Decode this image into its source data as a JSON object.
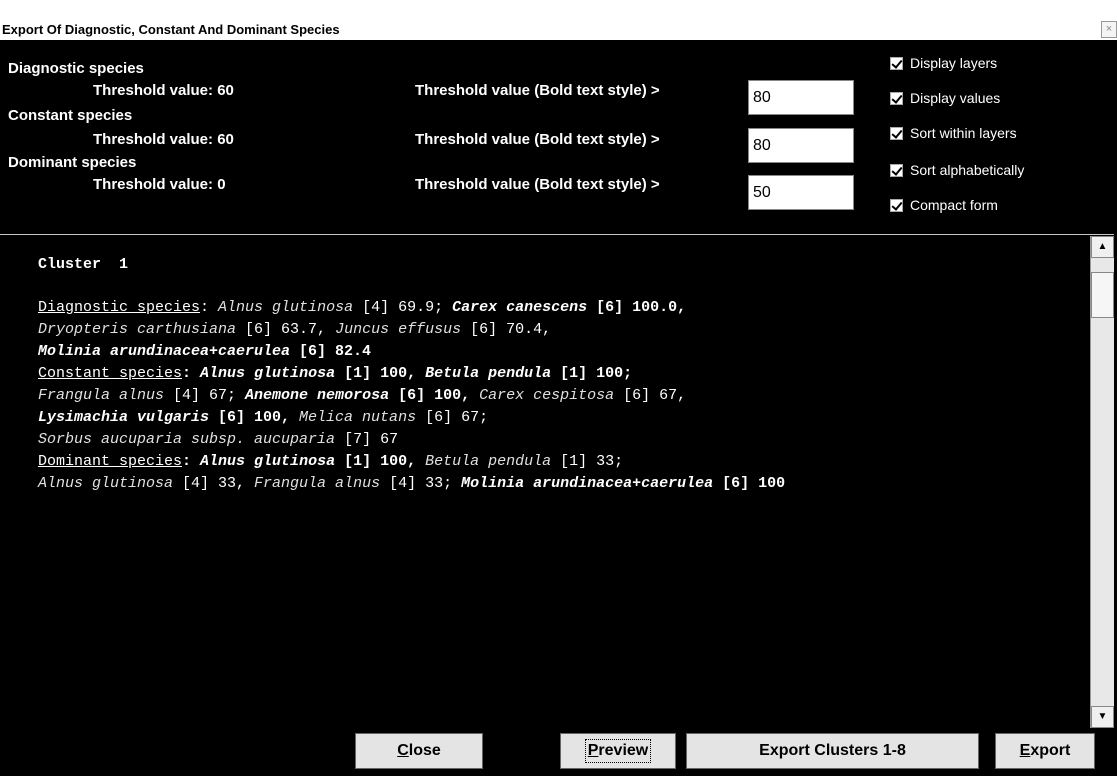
{
  "window": {
    "title": "Export Of Diagnostic, Constant And Dominant Species",
    "close_glyph": "×"
  },
  "thresholds": {
    "diagnostic": {
      "heading": "Diagnostic species",
      "threshold_label": "Threshold value: 60",
      "bold_label": "Threshold value (Bold text style) >",
      "bold_value": "80"
    },
    "constant": {
      "heading": "Constant species",
      "threshold_label": "Threshold value: 60",
      "bold_label": "Threshold value (Bold text style) >",
      "bold_value": "80"
    },
    "dominant": {
      "heading": "Dominant species",
      "threshold_label": "Threshold value: 0",
      "bold_label": "Threshold value (Bold text style) >",
      "bold_value": "50"
    }
  },
  "options": [
    {
      "label": "Display layers",
      "checked": true
    },
    {
      "label": "Display values",
      "checked": true
    },
    {
      "label": "Sort within layers",
      "checked": true
    },
    {
      "label": "Sort alphabetically",
      "checked": true
    },
    {
      "label": "Compact form",
      "checked": true
    }
  ],
  "preview": {
    "cluster_label": "Cluster  1",
    "lines": [
      [
        {
          "t": "Diagnostic species",
          "s": "u"
        },
        {
          "t": ": ",
          "s": ""
        },
        {
          "t": "Alnus glutinosa",
          "s": "it"
        },
        {
          "t": " [4] 69.9; ",
          "s": ""
        },
        {
          "t": "Carex canescens",
          "s": "bi"
        },
        {
          "t": " [6] 100.0,",
          "s": "b"
        }
      ],
      [
        {
          "t": "Dryopteris carthusiana",
          "s": "it"
        },
        {
          "t": " [6] 63.7, ",
          "s": ""
        },
        {
          "t": "Juncus effusus",
          "s": "it"
        },
        {
          "t": " [6] 70.4,",
          "s": ""
        }
      ],
      [
        {
          "t": "Molinia arundinacea+caerulea",
          "s": "bi"
        },
        {
          "t": " [6] 82.4",
          "s": "b"
        }
      ],
      [
        {
          "t": "Constant species",
          "s": "u"
        },
        {
          "t": ": ",
          "s": "b"
        },
        {
          "t": "Alnus glutinosa",
          "s": "bi"
        },
        {
          "t": " [1] 100, ",
          "s": "b"
        },
        {
          "t": "Betula pendula",
          "s": "bi"
        },
        {
          "t": " [1] 100;",
          "s": "b"
        }
      ],
      [
        {
          "t": "Frangula alnus",
          "s": "it"
        },
        {
          "t": " [4] 67; ",
          "s": ""
        },
        {
          "t": "Anemone nemorosa",
          "s": "bi"
        },
        {
          "t": " [6] 100, ",
          "s": "b"
        },
        {
          "t": "Carex cespitosa",
          "s": "it"
        },
        {
          "t": " [6] 67,",
          "s": ""
        }
      ],
      [
        {
          "t": "Lysimachia vulgaris",
          "s": "bi"
        },
        {
          "t": " [6] 100, ",
          "s": "b"
        },
        {
          "t": "Melica nutans",
          "s": "it"
        },
        {
          "t": " [6] 67;",
          "s": ""
        }
      ],
      [
        {
          "t": "Sorbus aucuparia subsp. aucuparia",
          "s": "it"
        },
        {
          "t": " [7] 67",
          "s": ""
        }
      ],
      [
        {
          "t": "Dominant species",
          "s": "u"
        },
        {
          "t": ": ",
          "s": "b"
        },
        {
          "t": "Alnus glutinosa",
          "s": "bi"
        },
        {
          "t": " [1] 100, ",
          "s": "b"
        },
        {
          "t": "Betula pendula",
          "s": "it"
        },
        {
          "t": " [1] 33;",
          "s": ""
        }
      ],
      [
        {
          "t": "Alnus glutinosa",
          "s": "it"
        },
        {
          "t": " [4] 33, ",
          "s": ""
        },
        {
          "t": "Frangula alnus",
          "s": "it"
        },
        {
          "t": " [4] 33; ",
          "s": ""
        },
        {
          "t": "Molinia arundinacea+caerulea",
          "s": "bi"
        },
        {
          "t": " [6] 100",
          "s": "b"
        }
      ]
    ]
  },
  "scrollbar": {
    "up_glyph": "▲",
    "down_glyph": "▼"
  },
  "buttons": {
    "close": {
      "mnemonic": "C",
      "rest": "lose"
    },
    "preview": {
      "mnemonic": "P",
      "rest": "review"
    },
    "export_clusters": {
      "label": "Export Clusters 1-8"
    },
    "export": {
      "mnemonic": "E",
      "rest": "xport"
    }
  }
}
